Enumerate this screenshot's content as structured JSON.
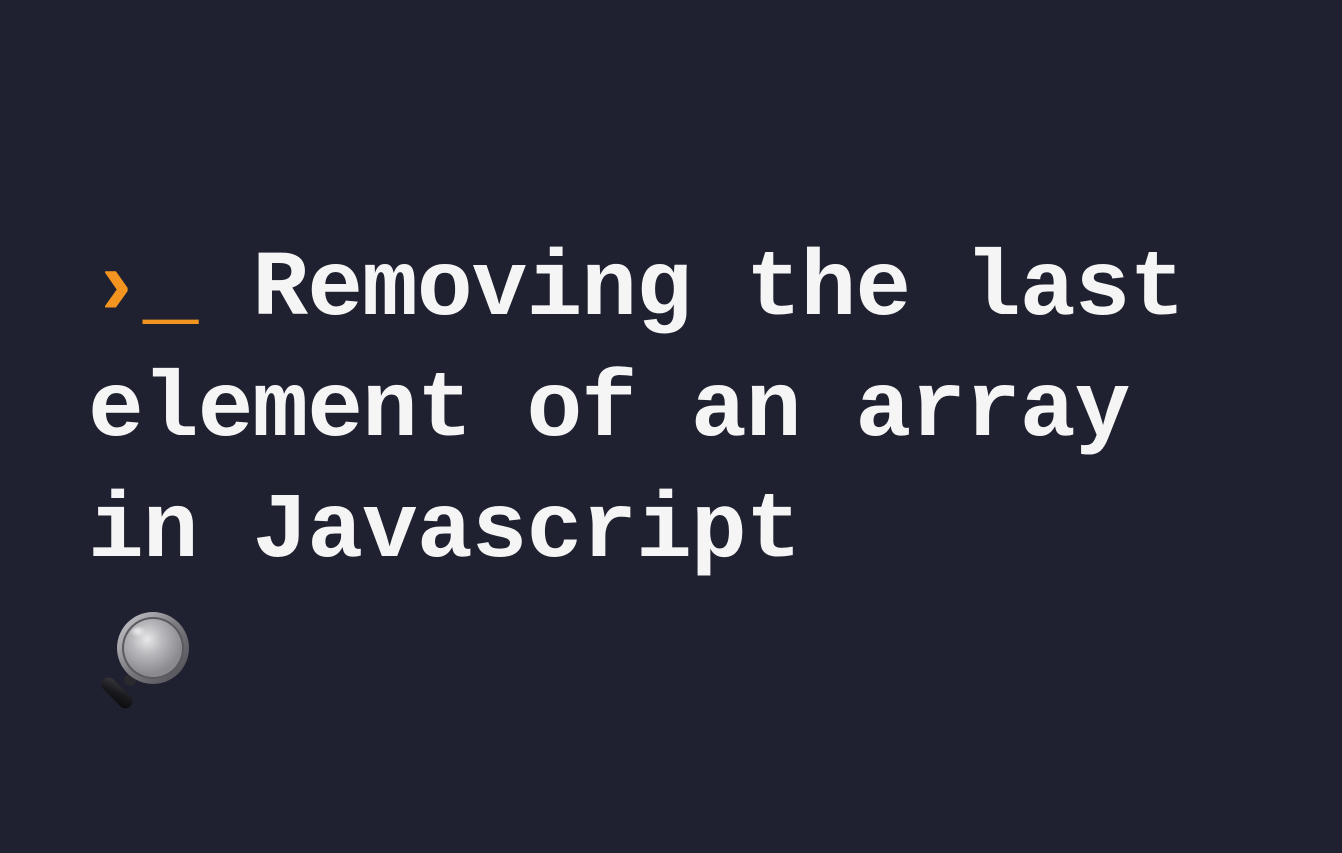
{
  "heading": {
    "prefix": "›_",
    "title": " Removing the last element of an array in Javascript"
  },
  "colors": {
    "background": "#1f2130",
    "text": "#f5f5f5",
    "accent": "#f39420"
  },
  "icons": {
    "magnifier": "magnifying-glass-icon"
  }
}
